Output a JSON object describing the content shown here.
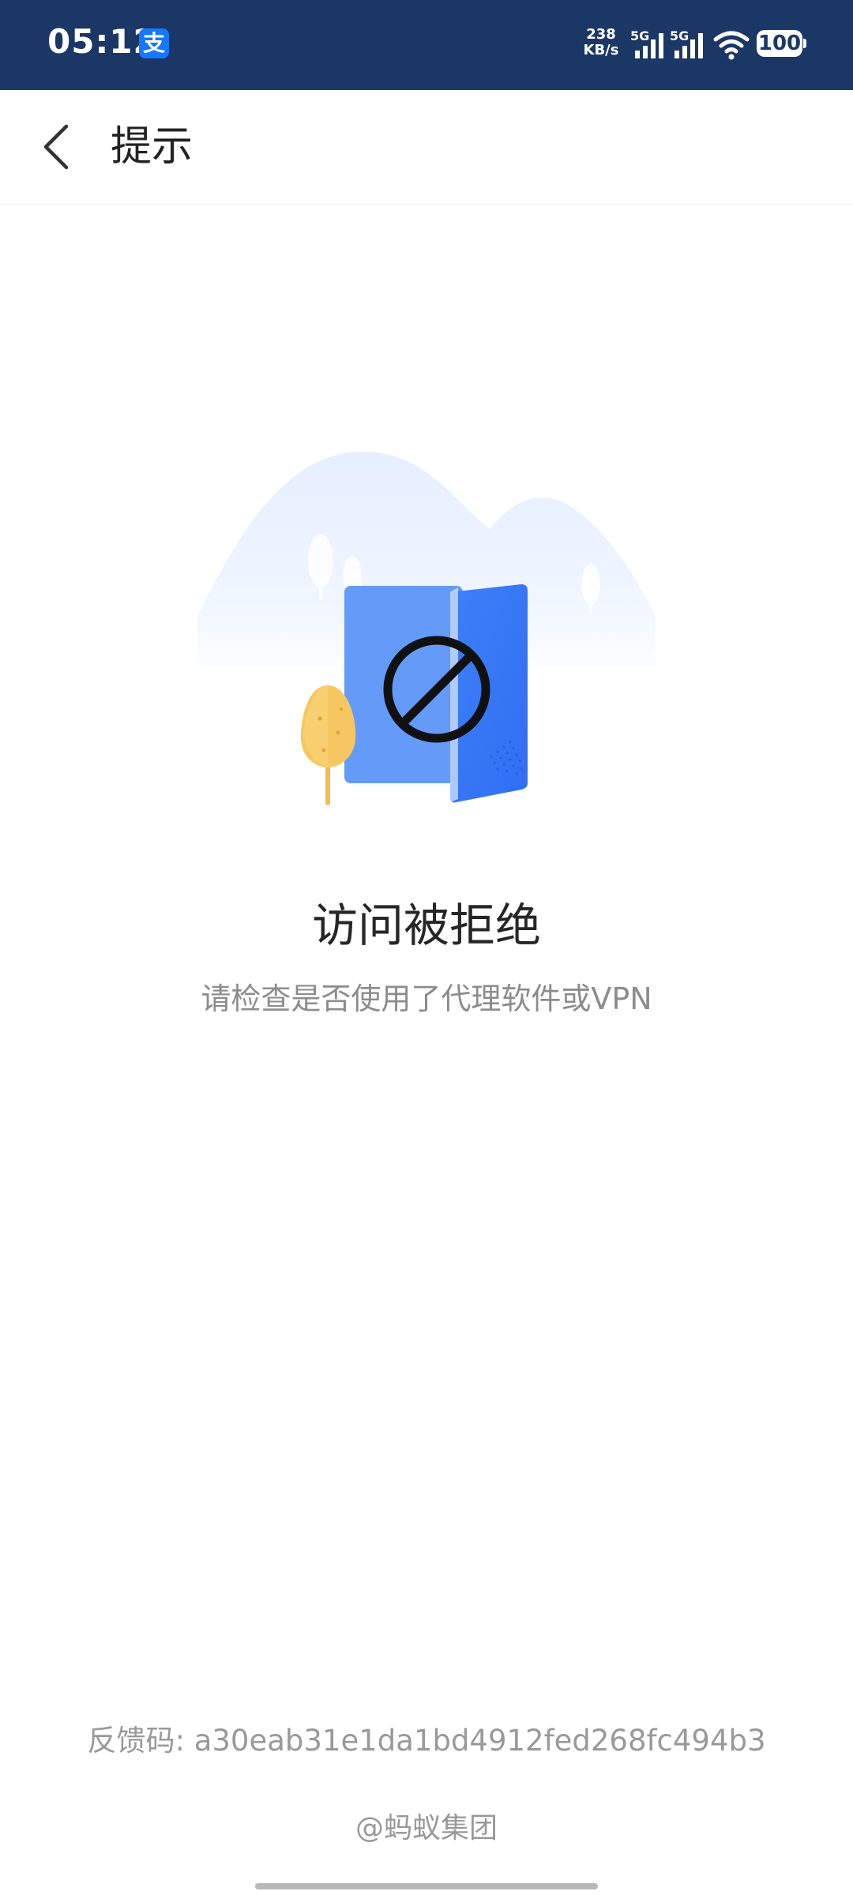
{
  "status_bar": {
    "time": "05:12",
    "app_badge": "支",
    "net_speed_value": "238",
    "net_speed_unit": "KB/s",
    "signal_1_label": "5G",
    "signal_2_label": "5G",
    "battery": "100",
    "background_color": "#1b3766"
  },
  "header": {
    "title": "提示"
  },
  "error": {
    "title": "访问被拒绝",
    "subtitle": "请检查是否使用了代理软件或VPN"
  },
  "footer": {
    "feedback_code": "反馈码: a30eab31e1da1bd4912fed268fc494b3",
    "brand": "@蚂蚁集团"
  },
  "colors": {
    "door_blue": "#4a86f7",
    "door_dark_blue": "#3d7af5",
    "tree_yellow": "#f6c760",
    "hill_tint": "#e9f2ff"
  }
}
